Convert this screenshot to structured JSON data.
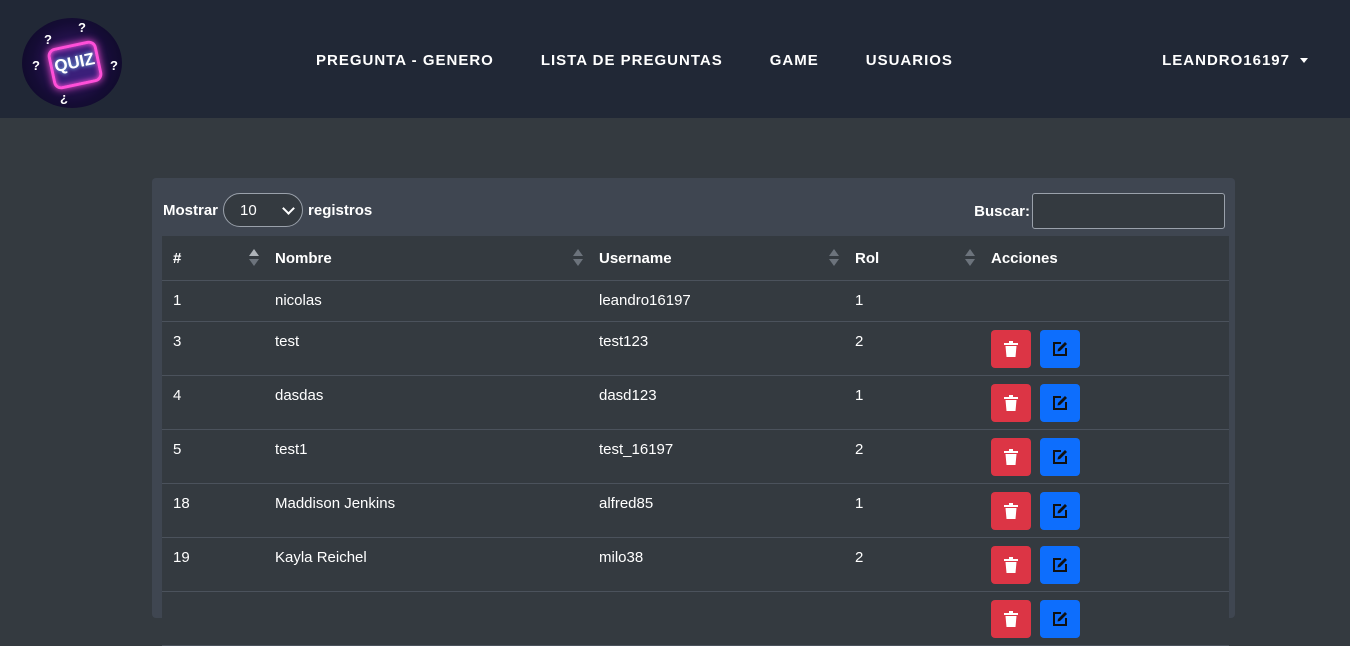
{
  "navbar": {
    "logo_text": "QUIZ",
    "links": [
      {
        "label": "PREGUNTA - GENERO"
      },
      {
        "label": "LISTA DE PREGUNTAS"
      },
      {
        "label": "GAME"
      },
      {
        "label": "USUARIOS"
      }
    ],
    "user": "LEANDRO16197"
  },
  "table_controls": {
    "show_label": "Mostrar",
    "page_size": "10",
    "records_label": "registros",
    "search_label": "Buscar:",
    "search_value": ""
  },
  "table": {
    "columns": [
      "#",
      "Nombre",
      "Username",
      "Rol",
      "Acciones"
    ],
    "rows": [
      {
        "id": "1",
        "nombre": "nicolas",
        "username": "leandro16197",
        "rol": "1",
        "actions": false
      },
      {
        "id": "3",
        "nombre": "test",
        "username": "test123",
        "rol": "2",
        "actions": true
      },
      {
        "id": "4",
        "nombre": "dasdas",
        "username": "dasd123",
        "rol": "1",
        "actions": true
      },
      {
        "id": "5",
        "nombre": "test1",
        "username": "test_16197",
        "rol": "2",
        "actions": true
      },
      {
        "id": "18",
        "nombre": "Maddison Jenkins",
        "username": "alfred85",
        "rol": "1",
        "actions": true
      },
      {
        "id": "19",
        "nombre": "Kayla Reichel",
        "username": "milo38",
        "rol": "2",
        "actions": true
      },
      {
        "id": "",
        "nombre": "",
        "username": "",
        "rol": "",
        "actions": true
      }
    ]
  },
  "icons": {
    "delete": "trash-icon",
    "edit": "edit-icon",
    "sort": "sort-icon"
  },
  "colors": {
    "navbar_bg": "#212836",
    "page_bg": "#343a40",
    "delete_button": "#dc3545",
    "edit_button": "#0d6efd"
  }
}
